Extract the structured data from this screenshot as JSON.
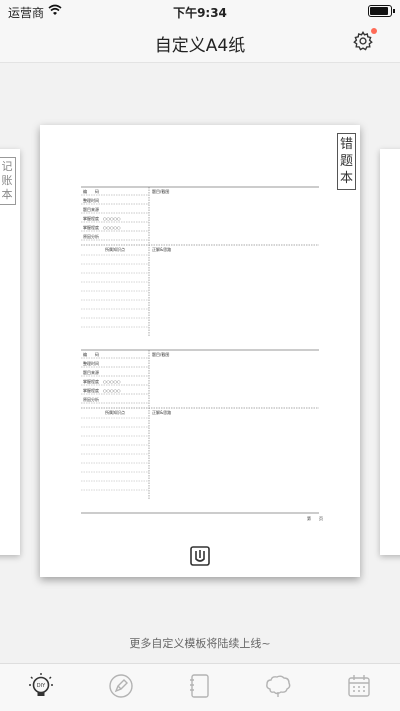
{
  "status": {
    "carrier": "运营商",
    "time": "下午9:34"
  },
  "nav": {
    "title": "自定义A4纸"
  },
  "cards": {
    "left_tag": "记账本",
    "main_tag": "错题本"
  },
  "template": {
    "blocks": [
      {
        "row_labels": [
          "编　　码",
          "整理时间",
          "题目来源",
          "掌握程度",
          "掌握程度",
          "原因分析"
        ],
        "right_top": "题目/截图",
        "knowledge": "所属知识点",
        "answer": "正解&思路"
      },
      {
        "row_labels": [
          "编　　码",
          "整理时间",
          "题目来源",
          "掌握程度",
          "掌握程度",
          "原因分析"
        ],
        "right_top": "题目/截图",
        "knowledge": "所属知识点",
        "answer": "正解&思路"
      }
    ],
    "page_label": "第　　页",
    "circles": "○○○○○"
  },
  "footer": {
    "text": "更多自定义模板将陆续上线~"
  },
  "tabs": [
    {
      "name": "diy",
      "icon": "bulb-icon",
      "active": true
    },
    {
      "name": "pen",
      "icon": "pen-icon",
      "active": false
    },
    {
      "name": "notebook",
      "icon": "notebook-icon",
      "active": false
    },
    {
      "name": "brain",
      "icon": "brain-icon",
      "active": false
    },
    {
      "name": "calendar",
      "icon": "calendar-icon",
      "active": false
    }
  ],
  "colors": {
    "accent_dot": "#ff6b57",
    "active_tab": "#333333",
    "inactive_tab": "#b3b3b3"
  }
}
